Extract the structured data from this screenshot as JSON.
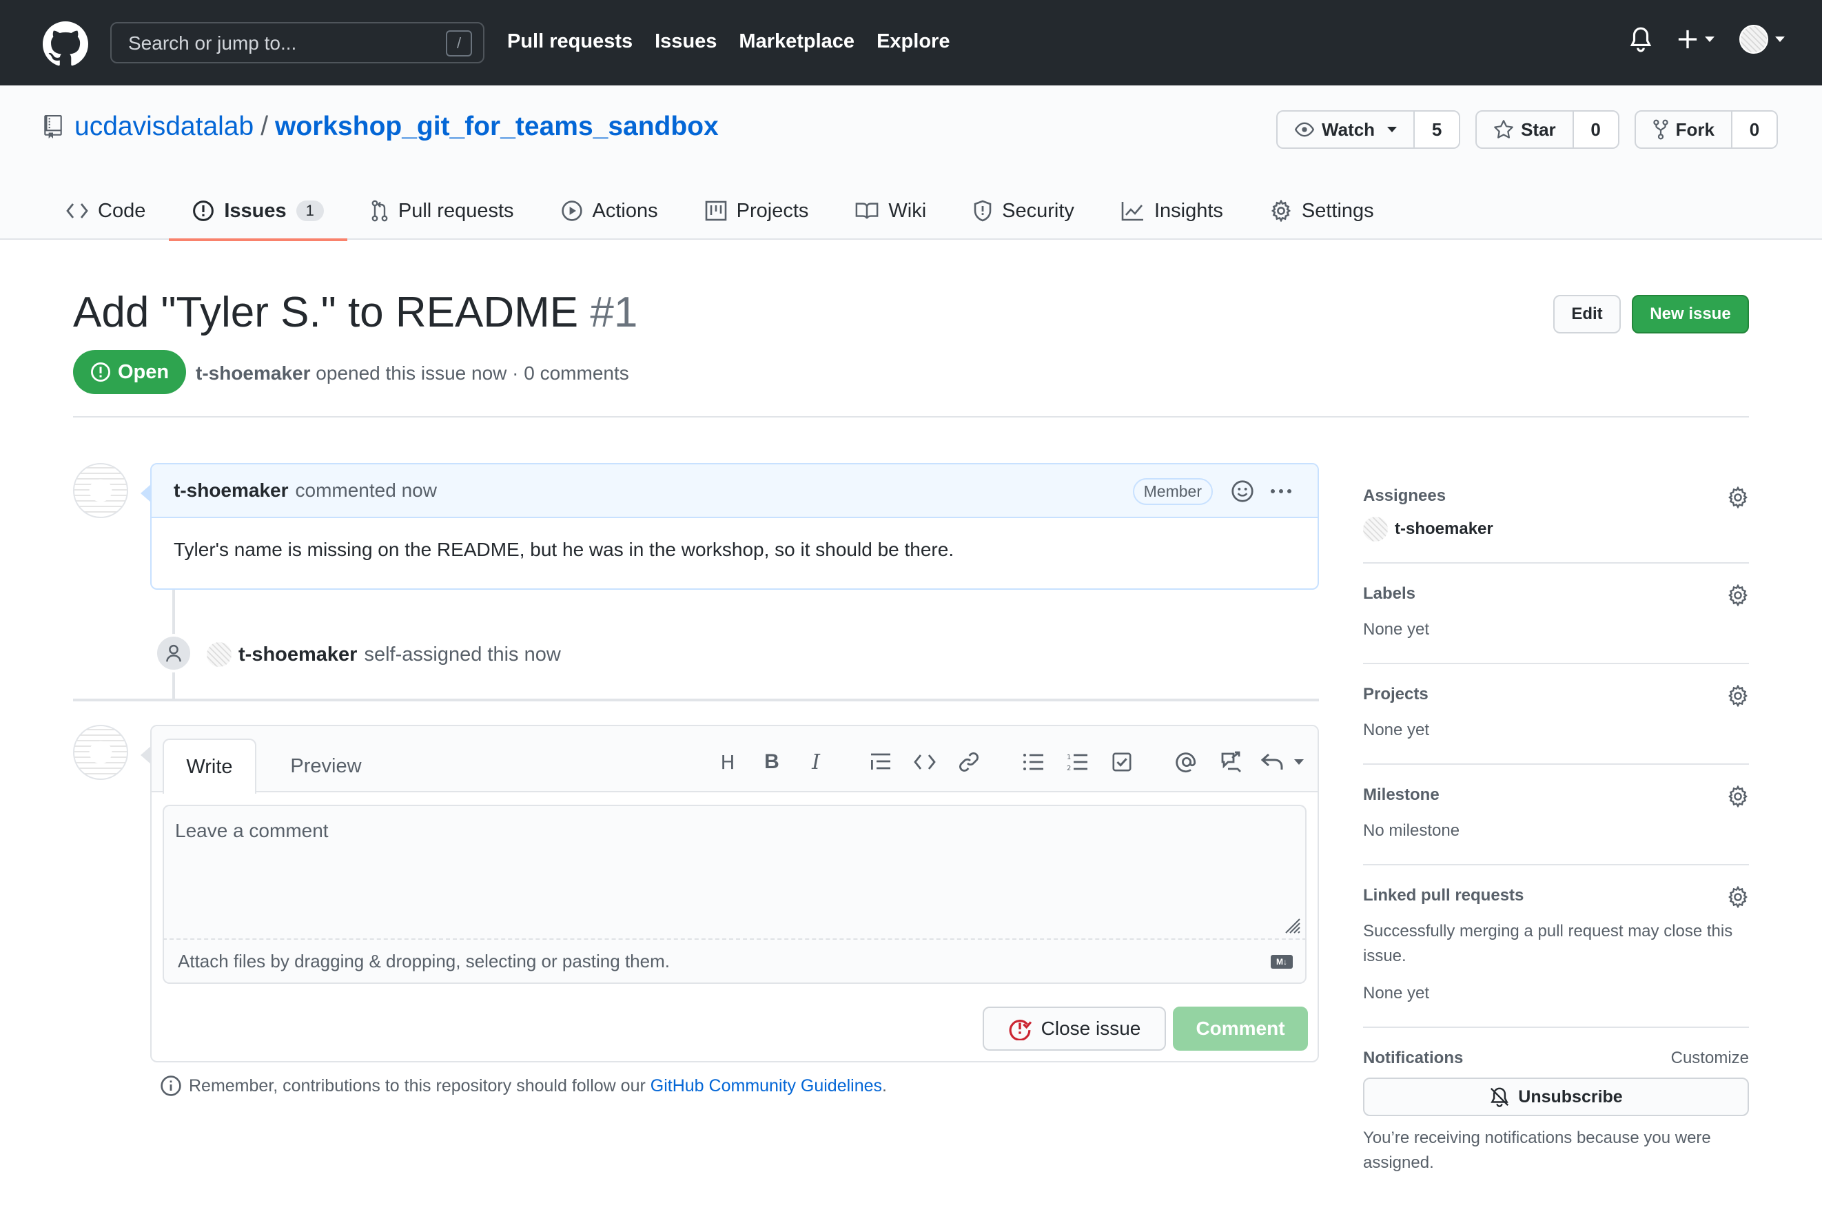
{
  "header": {
    "search_placeholder": "Search or jump to...",
    "search_shortcut": "/",
    "nav": [
      "Pull requests",
      "Issues",
      "Marketplace",
      "Explore"
    ]
  },
  "repo": {
    "owner": "ucdavisdatalab",
    "separator": "/",
    "name": "workshop_git_for_teams_sandbox",
    "watch": {
      "label": "Watch",
      "count": "5"
    },
    "star": {
      "label": "Star",
      "count": "0"
    },
    "fork": {
      "label": "Fork",
      "count": "0"
    }
  },
  "tabs": [
    {
      "label": "Code",
      "icon": "code-icon"
    },
    {
      "label": "Issues",
      "icon": "issue-opened-icon",
      "counter": "1",
      "active": true
    },
    {
      "label": "Pull requests",
      "icon": "git-pull-request-icon"
    },
    {
      "label": "Actions",
      "icon": "play-icon"
    },
    {
      "label": "Projects",
      "icon": "project-icon"
    },
    {
      "label": "Wiki",
      "icon": "book-icon"
    },
    {
      "label": "Security",
      "icon": "shield-icon"
    },
    {
      "label": "Insights",
      "icon": "graph-icon"
    },
    {
      "label": "Settings",
      "icon": "gear-icon"
    }
  ],
  "issue": {
    "title": "Add \"Tyler S.\" to README",
    "number": "#1",
    "state": "Open",
    "author": "t-shoemaker",
    "meta_rest": "opened this issue now · 0 comments",
    "edit_label": "Edit",
    "new_issue_label": "New issue"
  },
  "comment": {
    "author": "t-shoemaker",
    "action": "commented now",
    "role": "Member",
    "body": "Tyler's name is missing on the README, but he was in the workshop, so it should be there."
  },
  "event": {
    "actor": "t-shoemaker",
    "text": "self-assigned this now"
  },
  "form": {
    "write_tab": "Write",
    "preview_tab": "Preview",
    "placeholder": "Leave a comment",
    "attach_text": "Attach files by dragging & dropping, selecting or pasting them.",
    "markdown_badge": "M↓",
    "close_label": "Close issue",
    "comment_label": "Comment",
    "toolbar": {
      "heading": "H",
      "bold": "B",
      "italic": "I"
    }
  },
  "guidelines": {
    "prefix": "Remember, contributions to this repository should follow our",
    "link": "GitHub Community Guidelines",
    "suffix": "."
  },
  "sidebar": {
    "assignees": {
      "title": "Assignees",
      "user": "t-shoemaker"
    },
    "labels": {
      "title": "Labels",
      "value": "None yet"
    },
    "projects": {
      "title": "Projects",
      "value": "None yet"
    },
    "milestone": {
      "title": "Milestone",
      "value": "No milestone"
    },
    "linked": {
      "title": "Linked pull requests",
      "note": "Successfully merging a pull request may close this issue.",
      "value": "None yet"
    },
    "notifications": {
      "title": "Notifications",
      "customize": "Customize",
      "button": "Unsubscribe",
      "note": "You’re receiving notifications because you were assigned."
    }
  },
  "colors": {
    "header_bg": "#24292e",
    "link": "#0366d6",
    "green": "#2ea44f",
    "active_tab": "#f9826c"
  }
}
